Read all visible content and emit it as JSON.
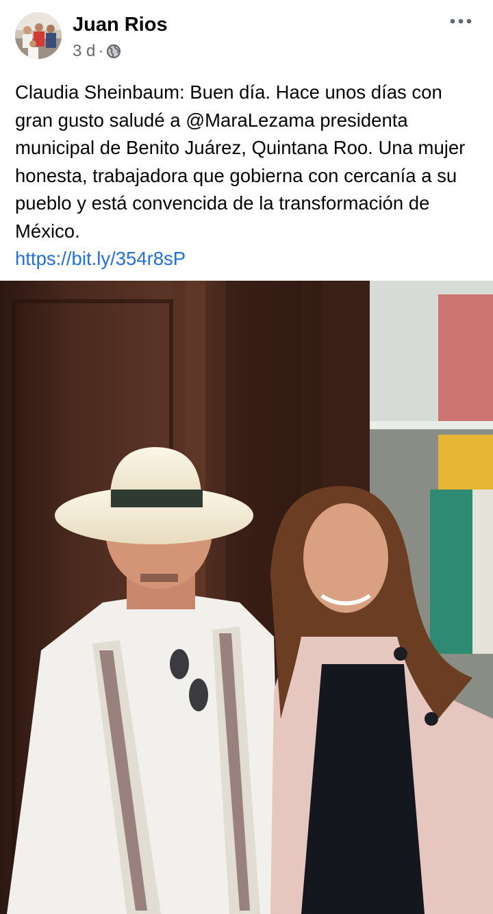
{
  "post": {
    "author": "Juan Rios",
    "timestamp": "3 d",
    "separator": "·",
    "audience_icon": "globe-icon",
    "more_icon": "more-horizontal-icon",
    "text": "Claudia Sheinbaum: Buen día. Hace unos días con gran gusto saludé a @MaraLezama presidenta municipal de Benito Juárez, Quintana Roo. Una mujer honesta, trabajadora que gobierna con cercanía a su pueblo y está convencida de la transformación de México.",
    "link": "https://bit.ly/354r8sP"
  },
  "colors": {
    "author": "#050505",
    "meta": "#65676b",
    "link": "#216fdb",
    "background": "#ffffff"
  }
}
